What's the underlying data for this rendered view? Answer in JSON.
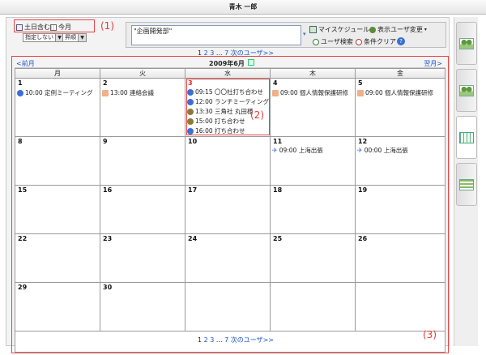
{
  "window_title": "青木 一郎",
  "toolbar": {
    "weekend_label": "土日含む",
    "month_label": "今月",
    "filter_select": "指定しない",
    "sort_select": "昇順"
  },
  "filter": {
    "group_value": "\"企画開発部\"",
    "my_schedule": "マイスケジュール",
    "change_users": "表示ユーザ変更",
    "user_search": "ユーザ検索",
    "clear": "条件クリア"
  },
  "pager": {
    "p1": "1",
    "p2": "2",
    "p3": "3",
    "dots": "...",
    "p7": "7",
    "next": "次のユーザ>>"
  },
  "calendar": {
    "title": "2009年6月",
    "prev": "<前月",
    "next": "翌月>",
    "weekdays": [
      "月",
      "火",
      "水",
      "木",
      "金"
    ]
  },
  "days": {
    "d1": "1",
    "d2": "2",
    "d3": "3",
    "d4": "4",
    "d5": "5",
    "d8": "8",
    "d9": "9",
    "d10": "10",
    "d11": "11",
    "d12": "12",
    "d15": "15",
    "d16": "16",
    "d17": "17",
    "d18": "18",
    "d19": "19",
    "d22": "22",
    "d23": "23",
    "d24": "24",
    "d25": "25",
    "d26": "26",
    "d29": "29",
    "d30": "30"
  },
  "events": {
    "e1": "10:00 定例ミーティング",
    "e2": "13:00 連絡会議",
    "e3a": "09:15 〇〇社打ち合わせ",
    "e3b": "12:00 ランチミーティング",
    "e3c": "13:30 三角社 丸田様",
    "e3d": "15:00 打ち合わせ",
    "e3e": "16:00 打ち合わせ",
    "e4": "09:00 個人情報保護研修",
    "e5": "09:00 個人情報保護研修",
    "e11": "09:00 上海出張",
    "e12": "00:00 上海出張"
  },
  "annotations": {
    "a1": "(1)",
    "a2": "(2)",
    "a3": "(3)"
  },
  "colors": {
    "link": "#1a55c7",
    "annotation": "#e83a3a",
    "today": "#e02020"
  }
}
